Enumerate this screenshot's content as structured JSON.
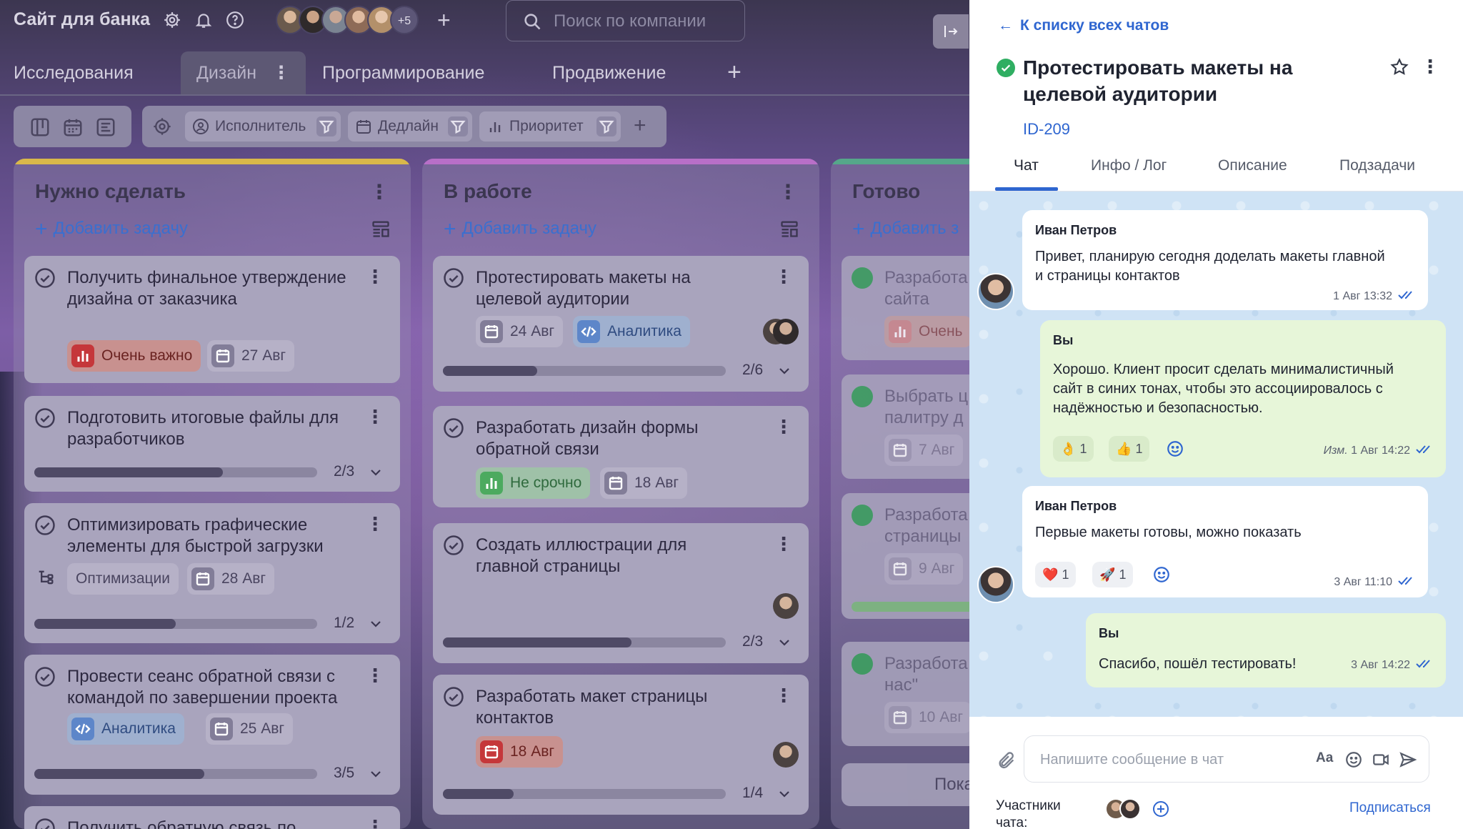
{
  "header": {
    "site_title": "Сайт для банка",
    "avatars_more": "+5",
    "search_placeholder": "Поиск по компании"
  },
  "tabs": [
    {
      "label": "Исследования"
    },
    {
      "label": "Дизайн",
      "active": true
    },
    {
      "label": "Программирование"
    },
    {
      "label": "Продвижение"
    }
  ],
  "toolbar": {
    "filters": [
      {
        "label": "Исполнитель",
        "icon": "user-icon"
      },
      {
        "label": "Дедлайн",
        "icon": "calendar-icon"
      },
      {
        "label": "Приоритет",
        "icon": "bars-icon"
      }
    ]
  },
  "columns": [
    {
      "title": "Нужно сделать",
      "add_label": "Добавить задачу",
      "accent": "#d9b84a",
      "cards": [
        {
          "title_l1": "Получить финальное утверждение",
          "title_l2": "дизайна от заказчика",
          "priority": "Очень важно",
          "date": "27 Авг"
        },
        {
          "title_l1": "Подготовить итоговые файлы для",
          "title_l2": "разработчиков",
          "progress": "2/3",
          "progress_value": 0.667
        },
        {
          "title_l1": "Оптимизировать графические",
          "title_l2": "элементы для быстрой загрузки",
          "tag": "Оптимизации",
          "date": "28 Авг",
          "progress": "1/2",
          "progress_value": 0.5
        },
        {
          "title_l1": "Провести сеанс обратной связи с",
          "title_l2": "командой по завершении проекта",
          "tag": "Аналитика",
          "date": "25 Авг",
          "progress": "3/5",
          "progress_value": 0.6
        },
        {
          "title_l1": "Получить обратную связь по"
        }
      ]
    },
    {
      "title": "В работе",
      "add_label": "Добавить задачу",
      "accent": "#b86fc8",
      "cards": [
        {
          "title_l1": "Протестировать макеты на",
          "title_l2": "целевой аудитории",
          "date": "24 Авг",
          "tag": "Аналитика",
          "progress": "2/6",
          "progress_value": 0.333
        },
        {
          "title_l1": "Разработать дизайн формы",
          "title_l2": "обратной связи",
          "priority": "Не срочно",
          "date": "18 Авг"
        },
        {
          "title_l1": "Создать иллюстрации для",
          "title_l2": "главной страницы",
          "progress": "2/3",
          "progress_value": 0.667
        },
        {
          "title_l1": "Разработать макет страницы",
          "title_l2": "контактов",
          "date": "18 Авг",
          "progress": "1/4",
          "progress_value": 0.25
        }
      ]
    },
    {
      "title": "Готово",
      "add_label": "Добавить з",
      "accent": "#55a78a",
      "cards": [
        {
          "title_l1": "Разработа",
          "title_l2": "сайта",
          "priority": "Очень"
        },
        {
          "title_l1": "Выбрать ц",
          "title_l2": "палитру д",
          "date": "7 Авг"
        },
        {
          "title_l1": "Разработа",
          "title_l2": "страницы",
          "date": "9 Авг"
        },
        {
          "title_l1": "Разработа",
          "title_l2": "нас\"",
          "date": "10 Авг"
        },
        {
          "title_l1": "Пока"
        }
      ]
    }
  ],
  "panel": {
    "back_label": "К списку всех чатов",
    "title_l1": "Протестировать макеты на",
    "title_l2": "целевой аудитории",
    "id": "ID-209",
    "tabs": [
      "Чат",
      "Инфо / Лог",
      "Описание",
      "Подзадачи"
    ],
    "messages": [
      {
        "author": "Иван Петров",
        "l1": "Привет, планирую сегодня доделать макеты главной",
        "l2": "и страницы контактов",
        "time": "1 Авг 13:32"
      },
      {
        "author": "Вы",
        "l1": "Хорошо. Клиент просит сделать минималистичный",
        "l2": "сайт в синих тонах, чтобы это ассоциировалось с",
        "l3": "надёжностью и безопасностью.",
        "edited": "Изм.",
        "time": "1 Авг 14:22",
        "reactions": [
          {
            "emoji": "👌",
            "count": "1"
          },
          {
            "emoji": "👍",
            "count": "1"
          }
        ]
      },
      {
        "author": "Иван Петров",
        "l1": "Первые макеты готовы, можно показать",
        "time": "3 Авг 11:10",
        "reactions": [
          {
            "emoji": "❤️",
            "count": "1"
          },
          {
            "emoji": "🚀",
            "count": "1"
          }
        ]
      },
      {
        "author": "Вы",
        "l1": "Спасибо, пошёл тестировать!",
        "time": "3 Авг 14:22"
      }
    ],
    "composer_placeholder": "Напишите сообщение в чат",
    "composer_aa": "Aa",
    "participants_l1": "Участники",
    "participants_l2": "чата:",
    "subscribe": "Подписаться"
  }
}
